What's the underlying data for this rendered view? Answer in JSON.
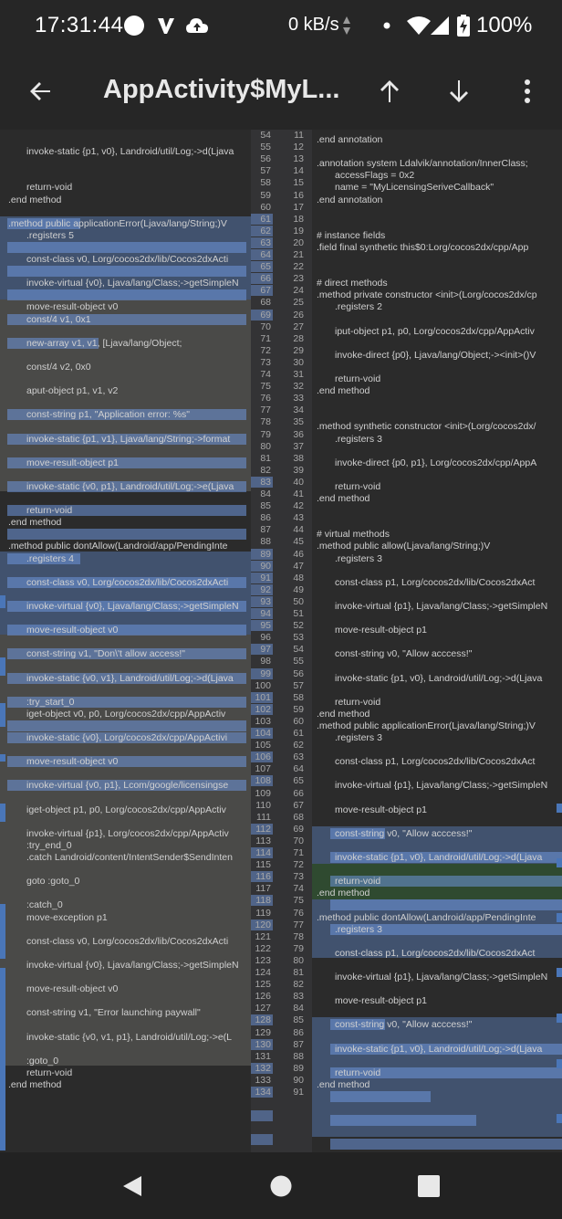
{
  "status_bar": {
    "time": "17:31:44",
    "net_speed": "0 kB/s",
    "battery": "100%",
    "icons": [
      "record-dot-icon",
      "v-logo-icon",
      "cloud-upload-icon",
      "speed-arrows-icon",
      "notification-dot-icon",
      "wifi-icon",
      "cell-signal-icon",
      "battery-charging-icon"
    ]
  },
  "app_bar": {
    "title": "AppActivity$MyL...",
    "back_icon": "arrow-back-icon",
    "prev_icon": "arrow-up-icon",
    "next_icon": "arrow-down-icon",
    "menu_icon": "more-vert-icon"
  },
  "diff": {
    "left_lines": [
      "invoke-static {p1, v0}, Landroid/util/Log;->d(Ljava",
      "return-void",
      ".end method",
      ".method public applicationError(Ljava/lang/String;)V",
      ".registers 5",
      "const-class v0, Lorg/cocos2dx/lib/Cocos2dxActi",
      "invoke-virtual {v0}, Ljava/lang/Class;->getSimpleN",
      "move-result-object v0",
      "const/4 v1, 0x1",
      "new-array v1, v1, [Ljava/lang/Object;",
      "const/4 v2, 0x0",
      "aput-object p1, v1, v2",
      "const-string p1, \"Application error: %s\"",
      "invoke-static {p1, v1}, Ljava/lang/String;->format",
      "move-result-object p1",
      "invoke-static {v0, p1}, Landroid/util/Log;->e(Ljava",
      "return-void",
      ".end method",
      ".method public dontAllow(Landroid/app/PendingInte",
      ".registers 4",
      "const-class v0, Lorg/cocos2dx/lib/Cocos2dxActi",
      "invoke-virtual {v0}, Ljava/lang/Class;->getSimpleN",
      "move-result-object v0",
      "const-string v1, \"Don\\'t allow access!\"",
      "invoke-static {v0, v1}, Landroid/util/Log;->d(Ljava",
      ":try_start_0",
      "iget-object v0, p0, Lorg/cocos2dx/cpp/AppActiv",
      "invoke-static {v0}, Lorg/cocos2dx/cpp/AppActivi",
      "move-result-object v0",
      "invoke-virtual {v0, p1}, Lcom/google/licensingse",
      "iget-object p1, p0, Lorg/cocos2dx/cpp/AppActiv",
      "invoke-virtual {p1}, Lorg/cocos2dx/cpp/AppActiv",
      ":try_end_0",
      ".catch Landroid/content/IntentSender$SendInten",
      "goto :goto_0",
      ":catch_0",
      "move-exception p1",
      "const-class v0, Lorg/cocos2dx/lib/Cocos2dxActi",
      "invoke-virtual {v0}, Ljava/lang/Class;->getSimpleN",
      "move-result-object v0",
      "const-string v1, \"Error launching paywall\"",
      "invoke-static {v0, v1, p1}, Landroid/util/Log;->e(L",
      ":goto_0",
      "return-void",
      ".end method"
    ],
    "right_lines": [
      ".end annotation",
      ".annotation system Ldalvik/annotation/InnerClass;",
      "accessFlags = 0x2",
      "name = \"MyLicensingSeriveCallback\"",
      ".end annotation",
      "# instance fields",
      ".field final synthetic this$0:Lorg/cocos2dx/cpp/App",
      "# direct methods",
      ".method private constructor <init>(Lorg/cocos2dx/cp",
      ".registers 2",
      "iput-object p1, p0, Lorg/cocos2dx/cpp/AppActiv",
      "invoke-direct {p0}, Ljava/lang/Object;-><init>()V",
      "return-void",
      ".end method",
      ".method synthetic constructor <init>(Lorg/cocos2dx/",
      ".registers 3",
      "invoke-direct {p0, p1}, Lorg/cocos2dx/cpp/AppA",
      "return-void",
      ".end method",
      "# virtual methods",
      ".method public allow(Ljava/lang/String;)V",
      ".registers 3",
      "const-class p1, Lorg/cocos2dx/lib/Cocos2dxAct",
      "invoke-virtual {p1}, Ljava/lang/Class;->getSimpleN",
      "move-result-object p1",
      "const-string v0, \"Allow acccess!\"",
      "invoke-static {p1, v0}, Landroid/util/Log;->d(Ljava",
      "return-void",
      ".end method",
      ".method public applicationError(Ljava/lang/String;)V",
      ".registers 3",
      "const-class p1, Lorg/cocos2dx/lib/Cocos2dxAct",
      "invoke-virtual {p1}, Ljava/lang/Class;->getSimpleN",
      "move-result-object p1",
      "const-string v0, \"Allow acccess!\"",
      "invoke-static {p1, v0}, Landroid/util/Log;->d(Ljava",
      "return-void",
      ".end method",
      ".method public dontAllow(Landroid/app/PendingInte",
      ".registers 3",
      "const-class p1, Lorg/cocos2dx/lib/Cocos2dxAct",
      "invoke-virtual {p1}, Ljava/lang/Class;->getSimpleN",
      "move-result-object p1",
      "const-string v0, \"Allow acccess!\"",
      "invoke-static {p1, v0}, Landroid/util/Log;->d(Ljava",
      "return-void",
      ".end method"
    ],
    "left_numbers": [
      "54",
      "55",
      "56",
      "57",
      "58",
      "59",
      "60",
      "61",
      "62",
      "63",
      "64",
      "65",
      "66",
      "67",
      "68",
      "69",
      "70",
      "71",
      "72",
      "73",
      "74",
      "75",
      "76",
      "77",
      "78",
      "79",
      "80",
      "81",
      "82",
      "83",
      "84",
      "85",
      "86",
      "87",
      "88",
      "89",
      "90",
      "91",
      "92",
      "93",
      "94",
      "95",
      "96",
      "97",
      "98",
      "99",
      "100",
      "101",
      "102",
      "103",
      "104",
      "105",
      "106",
      "107",
      "108",
      "109",
      "110",
      "111",
      "112",
      "113",
      "114",
      "115",
      "116",
      "117",
      "118",
      "119",
      "120",
      "121",
      "122",
      "123",
      "124",
      "125",
      "126",
      "127",
      "128",
      "129",
      "130",
      "131",
      "132",
      "133",
      "134"
    ],
    "right_numbers": [
      "11",
      "12",
      "13",
      "14",
      "15",
      "16",
      "17",
      "18",
      "19",
      "20",
      "21",
      "22",
      "23",
      "24",
      "25",
      "26",
      "27",
      "28",
      "29",
      "30",
      "31",
      "32",
      "33",
      "34",
      "35",
      "36",
      "37",
      "38",
      "39",
      "40",
      "41",
      "42",
      "43",
      "44",
      "45",
      "46",
      "47",
      "48",
      "49",
      "50",
      "51",
      "52",
      "53",
      "54",
      "55",
      "56",
      "57",
      "58",
      "59",
      "60",
      "61",
      "62",
      "63",
      "64",
      "65",
      "66",
      "67",
      "68",
      "69",
      "70",
      "71",
      "72",
      "73",
      "74",
      "75",
      "76",
      "77",
      "78",
      "79",
      "80",
      "81",
      "82",
      "83",
      "84",
      "85",
      "86",
      "87",
      "88",
      "89",
      "90",
      "91"
    ],
    "colors": {
      "changed_block": "#4a4a48",
      "removed_block": "#41526e",
      "added_block": "#2f4a30",
      "highlight": "#6e96dc"
    }
  },
  "nav_bar": {
    "back_icon": "nav-back-icon",
    "home_icon": "nav-home-icon",
    "recents_icon": "nav-recents-icon"
  }
}
